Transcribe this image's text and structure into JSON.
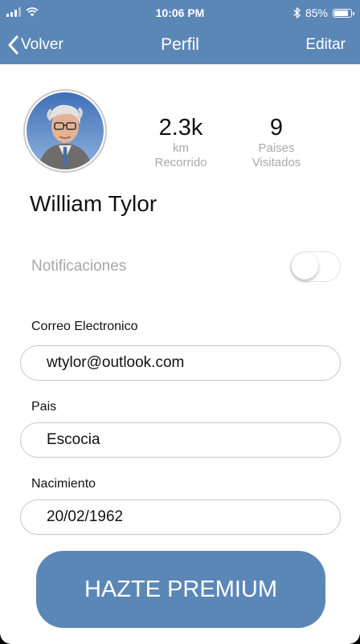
{
  "status_bar": {
    "time": "10:06 PM",
    "battery_percent": "85%",
    "battery_level": 0.85,
    "icons": [
      "signal-icon",
      "wifi-icon",
      "bluetooth-icon",
      "battery-icon"
    ]
  },
  "nav": {
    "back_label": "Volver",
    "title": "Perfil",
    "edit_label": "Editar",
    "bar_color": "#5b87b7"
  },
  "profile": {
    "name": "William Tylor",
    "stats": [
      {
        "value": "2.3k",
        "label_line1": "km",
        "label_line2": "Recorrido"
      },
      {
        "value": "9",
        "label_line1": "Paises",
        "label_line2": "Visitados"
      }
    ]
  },
  "settings": {
    "notifications_label": "Notificaciones",
    "notifications_enabled": false
  },
  "fields": {
    "email": {
      "label": "Correo Electronico",
      "value": "wtylor@outlook.com"
    },
    "country": {
      "label": "Pais",
      "value": "Escocia"
    },
    "birth": {
      "label": "Nacimiento",
      "value": "20/02/1962"
    }
  },
  "premium_button": {
    "label": "HAZTE PREMIUM"
  }
}
